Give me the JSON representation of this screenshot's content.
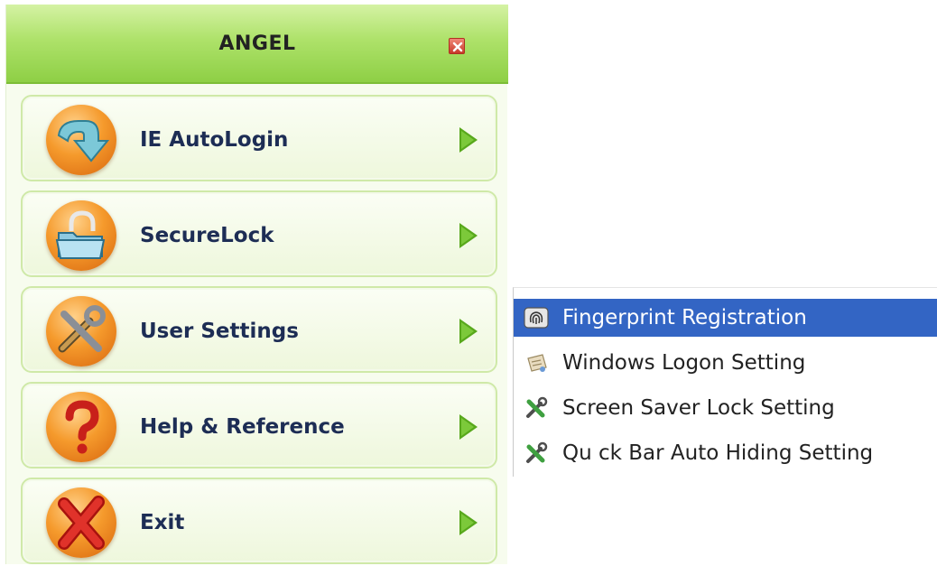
{
  "window": {
    "title": "ANGEL"
  },
  "menu": {
    "items": [
      {
        "label": "IE AutoLogin",
        "icon": "download-arrow-icon"
      },
      {
        "label": "SecureLock",
        "icon": "folder-lock-icon"
      },
      {
        "label": "User Settings",
        "icon": "tools-icon"
      },
      {
        "label": "Help & Reference",
        "icon": "question-mark-icon"
      },
      {
        "label": "Exit",
        "icon": "red-x-icon"
      }
    ]
  },
  "submenu": {
    "items": [
      {
        "label": "Fingerprint Registration",
        "icon": "fingerprint-icon",
        "selected": true
      },
      {
        "label": "Windows Logon Setting",
        "icon": "windows-logon-icon",
        "selected": false
      },
      {
        "label": "Screen Saver Lock Setting",
        "icon": "tools-icon",
        "selected": false
      },
      {
        "label": "Qu ck Bar Auto Hiding Setting",
        "icon": "tools-icon",
        "selected": false
      }
    ]
  },
  "colors": {
    "title_bar": "#aee26a",
    "highlight": "#3365c4",
    "arrow": "#58a81c",
    "orb": "#f59a2c"
  }
}
